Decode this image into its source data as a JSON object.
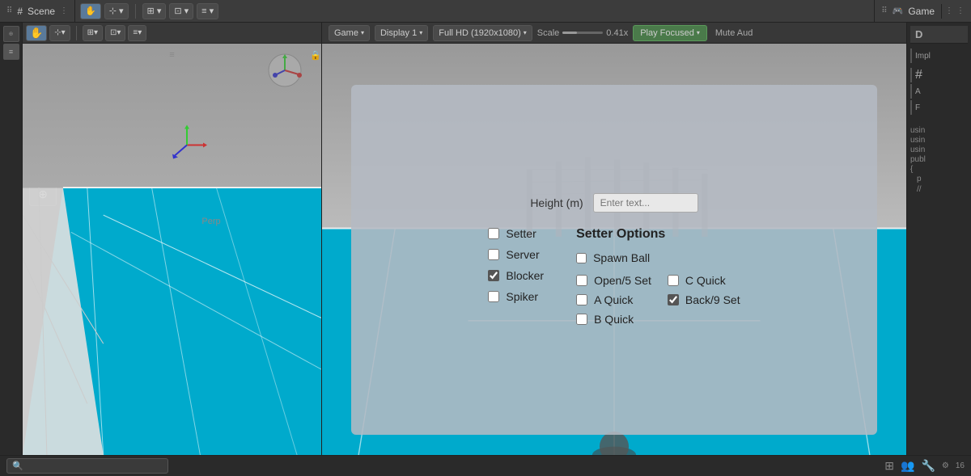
{
  "scene_panel": {
    "title": "Scene",
    "dots": "⋮",
    "persp_label": "Perp"
  },
  "game_panel": {
    "title": "Game",
    "dots": "⋮",
    "game_label": "Game",
    "display_label": "Display 1",
    "resolution_label": "Full HD (1920x1080)",
    "scale_label": "Scale",
    "scale_value": "0.41x",
    "play_focused_label": "Play Focused",
    "mute_label": "Mute Aud"
  },
  "dialog": {
    "height_label": "Height (m)",
    "height_placeholder": "Enter text...",
    "setter_label": "Setter",
    "server_label": "Server",
    "blocker_label": "Blocker",
    "spiker_label": "Spiker",
    "setter_options_title": "Setter Options",
    "spawn_ball_label": "Spawn Ball",
    "open5_label": "Open/5 Set",
    "c_quick_label": "C Quick",
    "a_quick_label": "A Quick",
    "back9_label": "Back/9 Set",
    "b_quick_label": "B Quick",
    "blocker_checked": true,
    "back9_checked": true
  },
  "right_panel": {
    "title": "D",
    "items": [
      "Impl",
      "#",
      "A",
      "F"
    ]
  },
  "right_code": {
    "lines": [
      "usin",
      "usin",
      "usin",
      "publ",
      "{",
      "    p",
      "",
      "    //"
    ]
  },
  "bottom_bar": {
    "search_placeholder": "",
    "version": "16"
  },
  "tools": {
    "hand": "✋",
    "move": "⊹",
    "rotate": "↻",
    "scale": "⊡",
    "rect": "⬜",
    "custom": "⊕"
  }
}
